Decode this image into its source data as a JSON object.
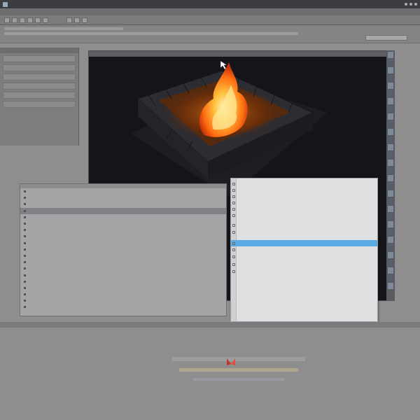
{
  "titlebar": {
    "title": "",
    "subtitle": ""
  },
  "menubar": {
    "items": [
      "",
      "",
      "",
      "",
      ""
    ]
  },
  "viewport": {
    "tabs": [
      "",
      "",
      "",
      "",
      ""
    ],
    "fire_colors": {
      "outer": "#ff7a18",
      "mid": "#ffb73a",
      "core": "#ffe89a",
      "glow": "#b0510c"
    },
    "brick_color": "#2a2b30",
    "floor_color": "#1e1f24"
  },
  "left_panel": {
    "rows": [
      "",
      "",
      "",
      "",
      "",
      ""
    ]
  },
  "code_panel": {
    "lines": [
      "",
      "",
      "",
      "",
      "",
      "",
      "",
      "",
      "",
      "",
      "",
      "",
      "",
      "",
      "",
      "",
      "",
      "",
      ""
    ],
    "selected_index": 3
  },
  "context_menu": {
    "items": [
      {
        "label": "",
        "shortcut": ""
      },
      {
        "label": "",
        "shortcut": ""
      },
      {
        "label": "",
        "shortcut": ""
      },
      {
        "label": "",
        "shortcut": ""
      },
      {
        "label": "",
        "shortcut": ""
      },
      {
        "label": "",
        "shortcut": ""
      },
      {
        "label": "",
        "shortcut": ""
      },
      {
        "label": "",
        "shortcut": ""
      },
      {
        "label": "",
        "shortcut": ""
      },
      {
        "label": "",
        "shortcut": ""
      },
      {
        "label": "",
        "shortcut": ""
      },
      {
        "label": "",
        "shortcut": ""
      },
      {
        "label": "",
        "shortcut": ""
      }
    ],
    "highlighted_index": 8,
    "footer_link": "",
    "highlight_color": "#5aaae5"
  },
  "status_bar": {
    "tabs": [
      "",
      ""
    ]
  }
}
